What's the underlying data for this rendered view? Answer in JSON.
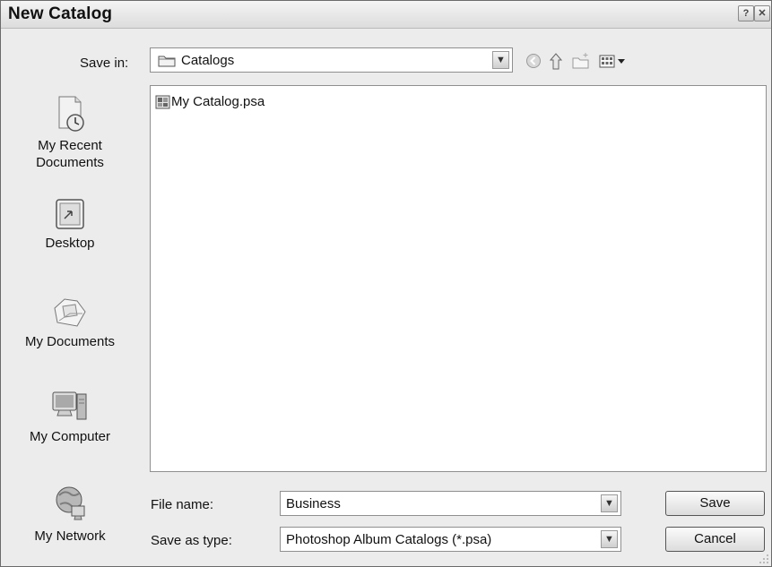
{
  "window": {
    "title": "New Catalog"
  },
  "titlebar_buttons": {
    "help_label": "?",
    "close_label": "✕"
  },
  "save_in": {
    "label": "Save in:",
    "value": "Catalogs"
  },
  "toolbar": {
    "icons": [
      "back-icon",
      "up-folder-icon",
      "new-folder-icon",
      "views-menu-icon"
    ]
  },
  "places": [
    {
      "label": "My Recent Documents",
      "icon": "recent-documents-icon"
    },
    {
      "label": "Desktop",
      "icon": "desktop-icon"
    },
    {
      "label": "My Documents",
      "icon": "my-documents-icon"
    },
    {
      "label": "My Computer",
      "icon": "my-computer-icon"
    },
    {
      "label": "My Network",
      "icon": "my-network-icon"
    }
  ],
  "files": [
    {
      "name": "My Catalog.psa",
      "icon": "catalog-file-icon"
    }
  ],
  "file_name": {
    "label": "File name:",
    "value": "Business"
  },
  "save_as_type": {
    "label": "Save as type:",
    "value": "Photoshop Album Catalogs (*.psa)"
  },
  "buttons": {
    "save": "Save",
    "cancel": "Cancel"
  }
}
